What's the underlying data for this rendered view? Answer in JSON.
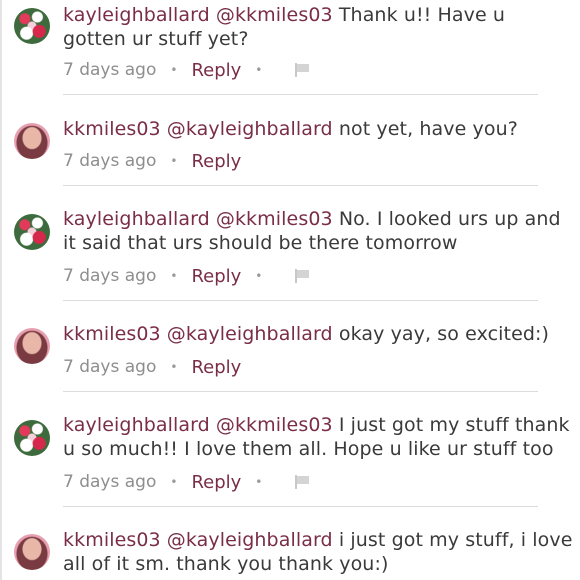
{
  "comments": [
    {
      "user": "kayleighballard",
      "mention": "@kkmiles03",
      "body": "Thank u!! Have u gotten ur stuff yet?",
      "time": "7 days ago",
      "reply": "Reply",
      "avatar": "flowers",
      "flag": true
    },
    {
      "user": "kkmiles03",
      "mention": "@kayleighballard",
      "body": "not yet, have you?",
      "time": "7 days ago",
      "reply": "Reply",
      "avatar": "person",
      "flag": false
    },
    {
      "user": "kayleighballard",
      "mention": "@kkmiles03",
      "body": "No. I looked urs up and it said that urs should be there tomorrow",
      "time": "7 days ago",
      "reply": "Reply",
      "avatar": "flowers",
      "flag": true
    },
    {
      "user": "kkmiles03",
      "mention": "@kayleighballard",
      "body": "okay yay, so excited:)",
      "time": "7 days ago",
      "reply": "Reply",
      "avatar": "person",
      "flag": false
    },
    {
      "user": "kayleighballard",
      "mention": "@kkmiles03",
      "body": "I just got my stuff thank u so much!! I love them all. Hope u like ur stuff too",
      "time": "7 days ago",
      "reply": "Reply",
      "avatar": "flowers",
      "flag": true
    },
    {
      "user": "kkmiles03",
      "mention": "@kayleighballard",
      "body": "i just got my stuff, i love all of it sm. thank you thank you:)",
      "time": "",
      "reply": "",
      "avatar": "person",
      "flag": false
    }
  ],
  "dot": "•"
}
